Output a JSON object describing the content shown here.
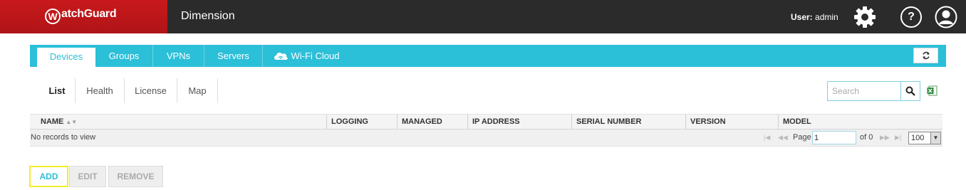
{
  "header": {
    "brand": "WatchGuard",
    "brand_initial": "W",
    "brand_rest": "atchGuard",
    "app_title": "Dimension",
    "user_prefix": "User:",
    "user_name": "admin",
    "help_label": "?"
  },
  "main_tabs": [
    {
      "label": "Devices",
      "active": true
    },
    {
      "label": "Groups",
      "active": false
    },
    {
      "label": "VPNs",
      "active": false
    },
    {
      "label": "Servers",
      "active": false
    },
    {
      "label": "Wi-Fi Cloud",
      "active": false
    }
  ],
  "sub_tabs": [
    {
      "label": "List",
      "active": true
    },
    {
      "label": "Health",
      "active": false
    },
    {
      "label": "License",
      "active": false
    },
    {
      "label": "Map",
      "active": false
    }
  ],
  "search": {
    "placeholder": "Search"
  },
  "grid": {
    "columns": [
      "NAME",
      "LOGGING",
      "MANAGED",
      "IP ADDRESS",
      "SERIAL NUMBER",
      "VERSION",
      "MODEL"
    ],
    "empty_text": "No records to view",
    "pager": {
      "page_label": "Page",
      "page_value": "1",
      "of_label": "of 0",
      "page_size": "100"
    }
  },
  "actions": {
    "add": "ADD",
    "edit": "EDIT",
    "remove": "REMOVE"
  },
  "colors": {
    "accent": "#2bbfd8",
    "brand_red": "#c8191c",
    "header_bg": "#2b2b2b",
    "highlight": "#f5ec2a"
  },
  "icons": [
    "gear-icon",
    "help-icon",
    "user-avatar-icon",
    "wifi-cloud-icon",
    "refresh-icon",
    "search-icon",
    "excel-export-icon",
    "sort-icon"
  ]
}
